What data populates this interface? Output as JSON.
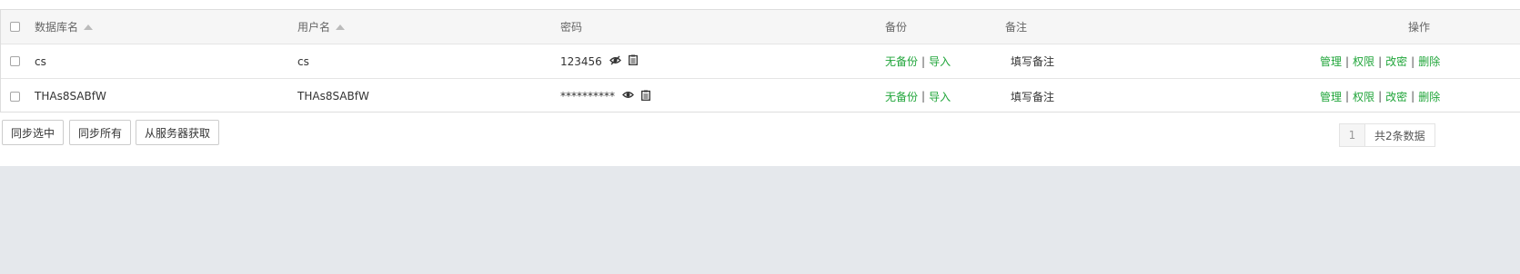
{
  "table": {
    "headers": {
      "db_name": "数据库名",
      "username": "用户名",
      "password": "密码",
      "backup": "备份",
      "note": "备注",
      "actions": "操作"
    },
    "rows": [
      {
        "db_name": "cs",
        "username": "cs",
        "password": "123456",
        "password_icon": "eye-slash-icon",
        "backup_none": "无备份",
        "backup_import": "导入",
        "note": "填写备注",
        "actions": [
          "管理",
          "权限",
          "改密",
          "删除"
        ]
      },
      {
        "db_name": "THAs8SABfW",
        "username": "THAs8SABfW",
        "password": "**********",
        "password_icon": "eye-icon",
        "backup_none": "无备份",
        "backup_import": "导入",
        "note": "填写备注",
        "actions": [
          "管理",
          "权限",
          "改密",
          "删除"
        ]
      }
    ]
  },
  "buttons": {
    "sync_selected": "同步选中",
    "sync_all": "同步所有",
    "fetch_from_server": "从服务器获取"
  },
  "pagination": {
    "current_page": "1",
    "total_text": "共2条数据"
  },
  "colors": {
    "link_green": "#20a53a",
    "header_bg": "#f6f6f6",
    "footer_bg": "#e5e8ec"
  }
}
